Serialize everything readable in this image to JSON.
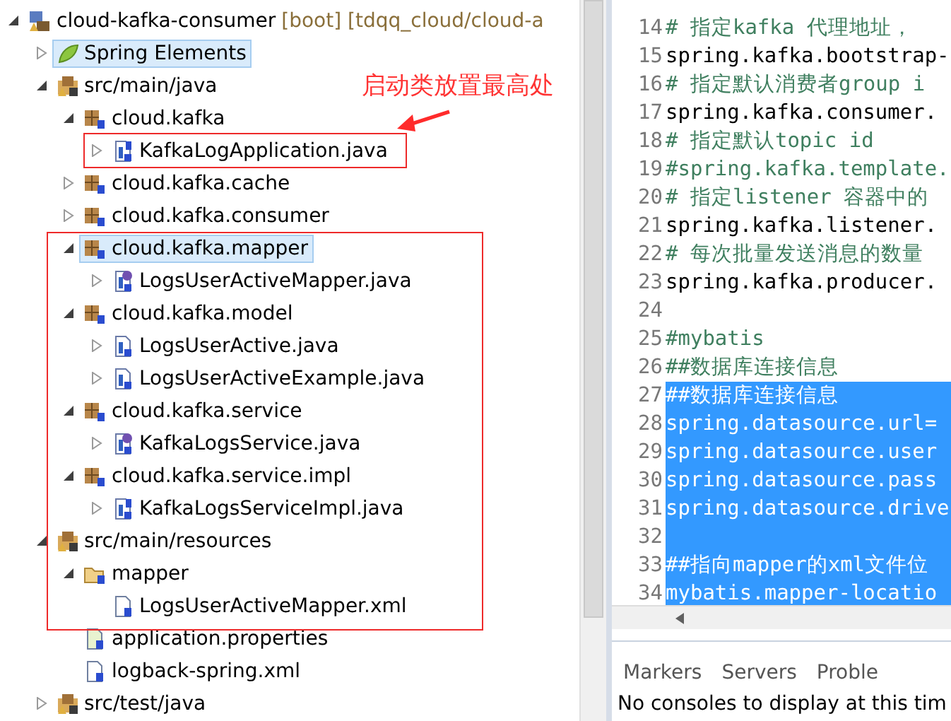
{
  "tree": [
    {
      "label": "cloud-kafka-consumer",
      "decoration": " [boot] [tdqq_cloud/cloud-a",
      "kind": "project",
      "expanded": true,
      "selected": false,
      "children": [
        {
          "label": "Spring Elements",
          "kind": "spring",
          "expanded": false,
          "selected": true
        },
        {
          "label": "src/main/java",
          "kind": "source-folder",
          "expanded": true,
          "selected": false,
          "children": [
            {
              "label": "cloud.kafka",
              "kind": "package",
              "expanded": true,
              "selected": false,
              "children": [
                {
                  "label": "KafkaLogApplication.java",
                  "kind": "java-class",
                  "expanded": false,
                  "selected": false
                }
              ]
            },
            {
              "label": "cloud.kafka.cache",
              "kind": "package",
              "expanded": false,
              "selected": false
            },
            {
              "label": "cloud.kafka.consumer",
              "kind": "package",
              "expanded": false,
              "selected": false
            },
            {
              "label": "cloud.kafka.mapper",
              "kind": "package",
              "expanded": true,
              "selected": true,
              "children": [
                {
                  "label": "LogsUserActiveMapper.java",
                  "kind": "java-interface",
                  "expanded": false,
                  "selected": false
                }
              ]
            },
            {
              "label": "cloud.kafka.model",
              "kind": "package",
              "expanded": true,
              "selected": false,
              "children": [
                {
                  "label": "LogsUserActive.java",
                  "kind": "java-file",
                  "expanded": false,
                  "selected": false
                },
                {
                  "label": "LogsUserActiveExample.java",
                  "kind": "java-file",
                  "expanded": false,
                  "selected": false
                }
              ]
            },
            {
              "label": "cloud.kafka.service",
              "kind": "package",
              "expanded": true,
              "selected": false,
              "children": [
                {
                  "label": "KafkaLogsService.java",
                  "kind": "java-interface",
                  "expanded": false,
                  "selected": false
                }
              ]
            },
            {
              "label": "cloud.kafka.service.impl",
              "kind": "package",
              "expanded": true,
              "selected": false,
              "children": [
                {
                  "label": "KafkaLogsServiceImpl.java",
                  "kind": "java-class",
                  "expanded": false,
                  "selected": false
                }
              ]
            }
          ]
        },
        {
          "label": "src/main/resources",
          "kind": "source-folder",
          "expanded": true,
          "selected": false,
          "children": [
            {
              "label": "mapper",
              "kind": "folder",
              "expanded": true,
              "selected": false,
              "children": [
                {
                  "label": "LogsUserActiveMapper.xml",
                  "kind": "xml",
                  "selected": false
                }
              ]
            },
            {
              "label": "application.properties",
              "kind": "properties",
              "selected": false
            },
            {
              "label": "logback-spring.xml",
              "kind": "xml",
              "selected": false
            }
          ]
        },
        {
          "label": "src/test/java",
          "kind": "source-folder",
          "expanded": false,
          "selected": false
        }
      ]
    }
  ],
  "annotation": "启动类放置最高处",
  "editor": {
    "lines": [
      {
        "number": "14",
        "kind": "comment",
        "text": "# 指定kafka 代理地址，",
        "selected": false
      },
      {
        "number": "15",
        "kind": "code",
        "text": "spring.kafka.bootstrap-",
        "selected": false
      },
      {
        "number": "16",
        "kind": "comment",
        "text": "# 指定默认消费者group i",
        "selected": false
      },
      {
        "number": "17",
        "kind": "code",
        "text": "spring.kafka.consumer.",
        "selected": false
      },
      {
        "number": "18",
        "kind": "comment",
        "text": "# 指定默认topic id",
        "selected": false
      },
      {
        "number": "19",
        "kind": "comment",
        "text": "#spring.kafka.template.",
        "selected": false
      },
      {
        "number": "20",
        "kind": "comment",
        "text": "# 指定listener 容器中的",
        "selected": false
      },
      {
        "number": "21",
        "kind": "code",
        "text": "spring.kafka.listener.",
        "selected": false
      },
      {
        "number": "22",
        "kind": "comment",
        "text": "# 每次批量发送消息的数量",
        "selected": false
      },
      {
        "number": "23",
        "kind": "code",
        "text": "spring.kafka.producer.",
        "selected": false
      },
      {
        "number": "24",
        "kind": "code",
        "selected": false
      },
      {
        "number": "25",
        "kind": "comment",
        "text": "#mybatis",
        "selected": false
      },
      {
        "number": "26",
        "kind": "comment",
        "text": "##数据库连接信息",
        "selected": false
      },
      {
        "number": "27",
        "kind": "comment",
        "text": "##数据库连接信息",
        "selected": true
      },
      {
        "number": "28",
        "kind": "code",
        "text": "spring.datasource.url=",
        "selected": true
      },
      {
        "number": "29",
        "kind": "code",
        "text": "spring.datasource.user",
        "selected": true
      },
      {
        "number": "30",
        "kind": "code",
        "text": "spring.datasource.pass",
        "selected": true
      },
      {
        "number": "31",
        "kind": "code",
        "text": "spring.datasource.drive",
        "selected": true
      },
      {
        "number": "32",
        "kind": "code",
        "selected": true
      },
      {
        "number": "33",
        "kind": "comment",
        "text": "##指向mapper的xml文件位",
        "selected": true
      },
      {
        "number": "34",
        "kind": "code",
        "text": "mybatis.mapper-locatio",
        "selected": true
      }
    ]
  },
  "bottom_panel": {
    "tabs": [
      {
        "label": "Markers",
        "selected": false
      },
      {
        "label": "Servers",
        "selected": false
      },
      {
        "label": "Proble",
        "selected": false
      }
    ],
    "message": "No consoles to display at this tim"
  }
}
